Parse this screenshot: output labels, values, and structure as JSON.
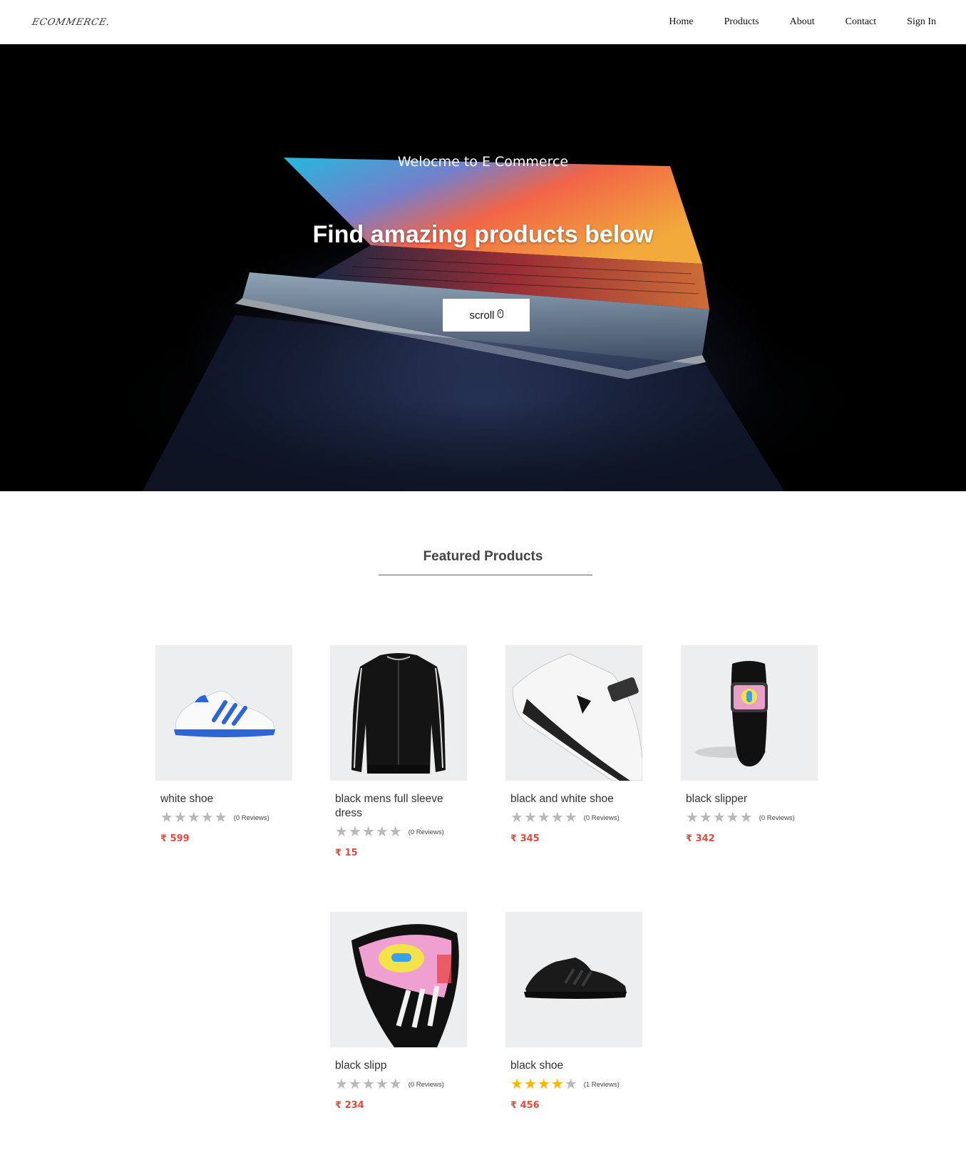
{
  "navbar": {
    "logo": "ECOMMERCE.",
    "links": [
      "Home",
      "Products",
      "About",
      "Contact",
      "Sign In"
    ]
  },
  "hero": {
    "welcome": "Welocme to E Commerce",
    "title": "Find amazing products below",
    "scroll_label": "scroll",
    "scroll_icon": "mouse-icon"
  },
  "featured": {
    "heading": "Featured Products",
    "products": [
      {
        "name": "white shoe",
        "rating": 0,
        "reviews": "(0 Reviews)",
        "currency": "₹",
        "price": "599",
        "image": "white-blue-sneaker"
      },
      {
        "name": "black mens full sleeve dress",
        "rating": 0,
        "reviews": "(0 Reviews)",
        "currency": "₹",
        "price": "15",
        "image": "black-track-jacket"
      },
      {
        "name": "black and white shoe",
        "rating": 0,
        "reviews": "(0 Reviews)",
        "currency": "₹",
        "price": "345",
        "image": "white-black-sneaker"
      },
      {
        "name": "black slipper",
        "rating": 0,
        "reviews": "(0 Reviews)",
        "currency": "₹",
        "price": "342",
        "image": "black-slide"
      },
      {
        "name": "black slipp",
        "rating": 0,
        "reviews": "(0 Reviews)",
        "currency": "₹",
        "price": "234",
        "image": "black-slide-closeup"
      },
      {
        "name": "black shoe",
        "rating": 4,
        "reviews": "(1 Reviews)",
        "currency": "₹",
        "price": "456",
        "image": "black-running-shoe"
      }
    ]
  },
  "colors": {
    "price": "#e4493c",
    "star_filled": "#ffb400",
    "star_empty": "#b8b8b8",
    "card_bg": "#eceeef"
  }
}
